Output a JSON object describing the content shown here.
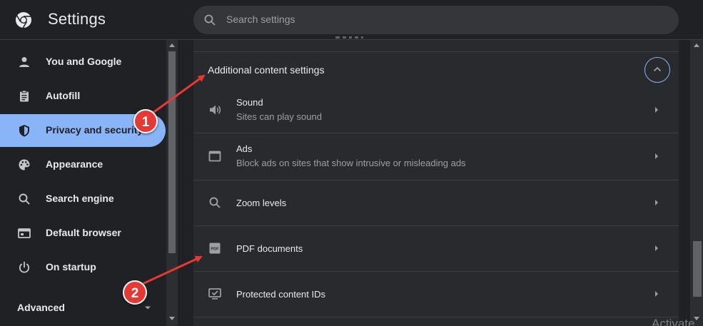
{
  "app": {
    "title": "Settings"
  },
  "search": {
    "placeholder": "Search settings"
  },
  "sidebar": {
    "items": [
      {
        "label": "You and Google",
        "icon": "person-icon"
      },
      {
        "label": "Autofill",
        "icon": "clipboard-icon"
      },
      {
        "label": "Privacy and security",
        "icon": "shield-icon",
        "active": true
      },
      {
        "label": "Appearance",
        "icon": "palette-icon"
      },
      {
        "label": "Search engine",
        "icon": "search-icon"
      },
      {
        "label": "Default browser",
        "icon": "browser-window-icon"
      },
      {
        "label": "On startup",
        "icon": "power-icon"
      }
    ],
    "advanced_label": "Advanced"
  },
  "content": {
    "section_title": "Additional content settings",
    "rows": [
      {
        "title": "Sound",
        "subtitle": "Sites can play sound",
        "icon": "speaker-icon"
      },
      {
        "title": "Ads",
        "subtitle": "Block ads on sites that show intrusive or misleading ads",
        "icon": "ads-window-icon"
      },
      {
        "title": "Zoom levels",
        "icon": "zoom-icon"
      },
      {
        "title": "PDF documents",
        "icon": "pdf-icon"
      },
      {
        "title": "Protected content IDs",
        "icon": "monitor-check-icon"
      }
    ]
  },
  "annotations": {
    "badge_1": "1",
    "badge_2": "2",
    "color": "#e53935"
  },
  "watermark": "Activate",
  "colors": {
    "background": "#202124",
    "card": "#292a2d",
    "accent": "#8ab4f8",
    "text": "#e8eaed",
    "secondary_text": "#9aa0a6"
  }
}
